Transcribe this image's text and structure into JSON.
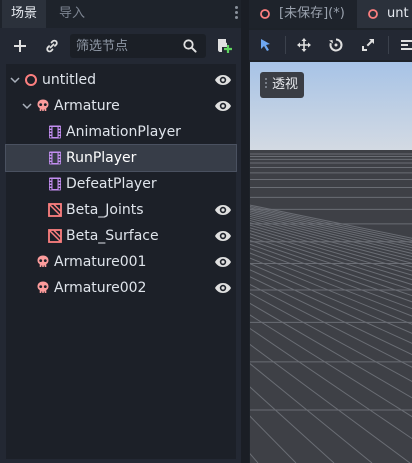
{
  "scene_dock": {
    "tabs": [
      {
        "label": "场景",
        "active": true
      },
      {
        "label": "导入",
        "active": false
      }
    ],
    "filter": {
      "placeholder": "筛选节点",
      "value": ""
    },
    "icons": [
      "add-icon",
      "link-icon",
      "search-icon",
      "script-add-icon",
      "kebab-menu-icon"
    ],
    "tree": [
      {
        "label": "untitled",
        "icon": "scene-root-icon",
        "depth": 0,
        "expanded": true,
        "visible_toggle": true,
        "selected": false
      },
      {
        "label": "Armature",
        "icon": "skeleton-icon",
        "depth": 1,
        "expanded": true,
        "visible_toggle": true,
        "selected": false
      },
      {
        "label": "AnimationPlayer",
        "icon": "animation-player-icon",
        "depth": 2,
        "visible_toggle": false,
        "selected": false
      },
      {
        "label": "RunPlayer",
        "icon": "animation-player-icon",
        "depth": 2,
        "visible_toggle": false,
        "selected": true
      },
      {
        "label": "DefeatPlayer",
        "icon": "animation-player-icon",
        "depth": 2,
        "visible_toggle": false,
        "selected": false
      },
      {
        "label": "Beta_Joints",
        "icon": "mesh-instance-icon",
        "depth": 2,
        "visible_toggle": true,
        "selected": false
      },
      {
        "label": "Beta_Surface",
        "icon": "mesh-instance-icon",
        "depth": 2,
        "visible_toggle": true,
        "selected": false
      },
      {
        "label": "Armature001",
        "icon": "skeleton-icon",
        "depth": 1,
        "visible_toggle": true,
        "selected": false
      },
      {
        "label": "Armature002",
        "icon": "skeleton-icon",
        "depth": 1,
        "visible_toggle": true,
        "selected": false
      }
    ]
  },
  "editor_tabs": [
    {
      "label": "[未保存](*)",
      "icon": "scene-root-icon"
    },
    {
      "label": "unt",
      "icon": "scene-root-icon",
      "active": true
    }
  ],
  "viewport": {
    "perspective_label": "透视",
    "toolbar_icons": [
      "select-tool-icon",
      "move-tool-icon",
      "rotate-tool-icon",
      "scale-tool-icon",
      "more-tool-icon"
    ]
  },
  "colors": {
    "accent": "#6ea7f2",
    "scene_root": "#fc7f7f",
    "skeleton": "#fc9c9c",
    "animation_player": "#c38ef1"
  }
}
